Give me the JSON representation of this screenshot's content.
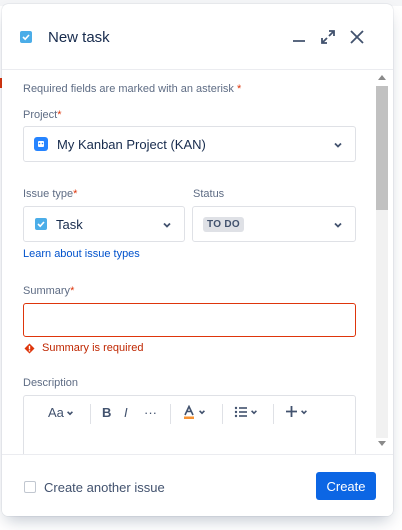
{
  "modal": {
    "title": "New task",
    "required_note": "Required fields are marked with an asterisk",
    "asterisk": "*"
  },
  "project": {
    "label": "Project",
    "value": "My Kanban Project (KAN)",
    "icon": "project-avatar-icon"
  },
  "issue_type": {
    "label": "Issue type",
    "value": "Task",
    "icon": "task-checkbox-icon"
  },
  "status": {
    "label": "Status",
    "value": "TO DO"
  },
  "learn_link": "Learn about issue types",
  "summary": {
    "label": "Summary",
    "value": "",
    "error": "Summary is required"
  },
  "description": {
    "label": "Description",
    "toolbar": {
      "text_style": "Aa",
      "bold": "B",
      "italic": "I",
      "more": "···"
    }
  },
  "footer": {
    "create_another": "Create another issue",
    "create_another_checked": false,
    "create_button": "Create"
  },
  "colors": {
    "accent": "#0c66e4",
    "error": "#de350b",
    "task_blue": "#4bade8"
  }
}
